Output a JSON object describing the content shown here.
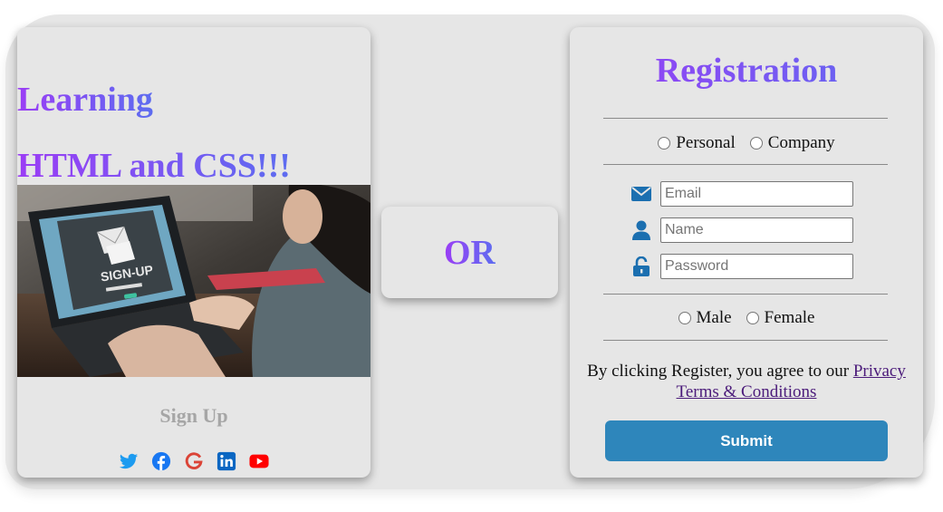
{
  "left_card": {
    "heading_line1": "Learning",
    "heading_line2": "HTML and CSS!!!",
    "image_text": "SIGN-UP",
    "signup_label": "Sign Up",
    "social_icons": [
      "twitter-icon",
      "facebook-icon",
      "google-icon",
      "linkedin-icon",
      "youtube-icon"
    ]
  },
  "or_card": {
    "text": "OR"
  },
  "registration": {
    "title": "Registration",
    "account_type": {
      "options": [
        "Personal",
        "Company"
      ]
    },
    "fields": {
      "email_placeholder": "Email",
      "name_placeholder": "Name",
      "password_placeholder": "Password"
    },
    "gender": {
      "options": [
        "Male",
        "Female"
      ]
    },
    "agree_prefix": "By clicking Register, you agree to our",
    "privacy_link": "Privacy",
    "terms_link": "Terms & Conditions",
    "submit_label": "Submit"
  },
  "colors": {
    "gradient_start": "#9b3df5",
    "gradient_end": "#5d6cf0",
    "submit_bg": "#2e86bb",
    "icon_blue": "#1b6fb0",
    "card_bg": "#e6e6e6"
  }
}
